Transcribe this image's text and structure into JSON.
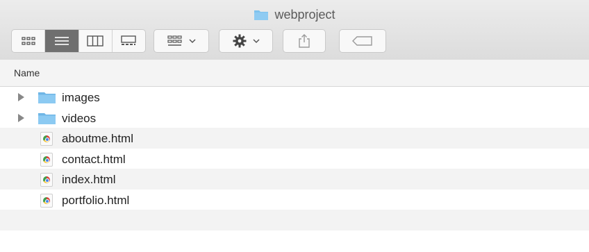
{
  "window": {
    "title": "webproject"
  },
  "toolbar": {
    "view_buttons": [
      "icon-view",
      "list-view",
      "column-view",
      "gallery-view"
    ],
    "active_view": "list-view"
  },
  "list": {
    "column_header": "Name",
    "items": [
      {
        "label": "images",
        "kind": "folder",
        "expandable": true
      },
      {
        "label": "videos",
        "kind": "folder",
        "expandable": true
      },
      {
        "label": "aboutme.html",
        "kind": "html-file",
        "expandable": false
      },
      {
        "label": "contact.html",
        "kind": "html-file",
        "expandable": false
      },
      {
        "label": "index.html",
        "kind": "html-file",
        "expandable": false
      },
      {
        "label": "portfolio.html",
        "kind": "html-file",
        "expandable": false
      }
    ]
  },
  "colors": {
    "folder": "#7ec2ee",
    "active_segment": "#6f6f6f",
    "row_alt": "#f3f3f3"
  }
}
